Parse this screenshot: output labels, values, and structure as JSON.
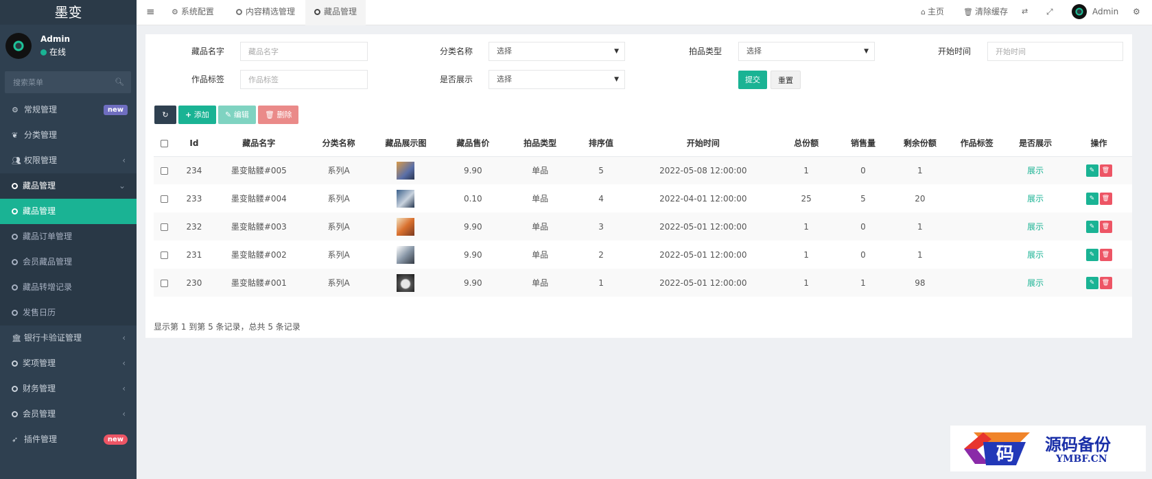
{
  "app": {
    "title": "墨变",
    "user_name": "Admin",
    "user_status": "在线",
    "search_placeholder": "搜索菜单"
  },
  "sidebar": {
    "items": [
      {
        "label": "常规管理",
        "icon": "gears-icon",
        "badge": "new",
        "badge_color": "#6f6ec0"
      },
      {
        "label": "分类管理",
        "icon": "leaf-icon"
      },
      {
        "label": "权限管理",
        "icon": "users-icon",
        "arrow": "‹"
      },
      {
        "label": "藏品管理",
        "icon": "circle-icon",
        "arrow": "⌄",
        "state": "open"
      },
      {
        "label": "藏品管理",
        "icon": "circle-icon",
        "state": "active"
      },
      {
        "label": "藏品订单管理",
        "icon": "circle-icon",
        "state": "sub"
      },
      {
        "label": "会员藏品管理",
        "icon": "circle-icon",
        "state": "sub"
      },
      {
        "label": "藏品转增记录",
        "icon": "circle-icon",
        "state": "sub"
      },
      {
        "label": "发售日历",
        "icon": "circle-icon",
        "state": "sub"
      },
      {
        "label": "银行卡验证管理",
        "icon": "bank-icon",
        "arrow": "‹"
      },
      {
        "label": "奖项管理",
        "icon": "circle-icon",
        "arrow": "‹"
      },
      {
        "label": "财务管理",
        "icon": "circle-icon",
        "arrow": "‹"
      },
      {
        "label": "会员管理",
        "icon": "circle-icon",
        "arrow": "‹"
      },
      {
        "label": "插件管理",
        "icon": "rocket-icon",
        "badge": "new",
        "badge_color": "#ed5565"
      }
    ]
  },
  "topbar": {
    "menu_icon": "≡",
    "tabs": [
      {
        "label": "系统配置",
        "icon": "gear-icon"
      },
      {
        "label": "内容精选管理",
        "icon": "circle-icon"
      },
      {
        "label": "藏品管理",
        "icon": "circle-icon",
        "active": true
      }
    ],
    "home": "主页",
    "clear_cache": "清除缓存",
    "user": "Admin"
  },
  "filters": {
    "name_label": "藏品名字",
    "name_placeholder": "藏品名字",
    "category_label": "分类名称",
    "category_value": "选择",
    "type_label": "拍品类型",
    "type_value": "选择",
    "start_label": "开始时间",
    "start_placeholder": "开始时间",
    "tag_label": "作品标签",
    "tag_placeholder": "作品标签",
    "show_label": "是否展示",
    "show_value": "选择",
    "submit": "提交",
    "reset": "重置"
  },
  "toolbar": {
    "add": "添加",
    "edit": "编辑",
    "delete": "删除"
  },
  "table": {
    "columns": [
      "Id",
      "藏品名字",
      "分类名称",
      "藏品展示图",
      "藏品售价",
      "拍品类型",
      "排序值",
      "开始时间",
      "总份额",
      "销售量",
      "剩余份额",
      "作品标签",
      "是否展示",
      "操作"
    ],
    "rows": [
      {
        "id": "234",
        "name": "墨变骷髅#005",
        "category": "系列A",
        "price": "9.90",
        "type": "单品",
        "sort": "5",
        "start": "2022-05-08 12:00:00",
        "total": "1",
        "sold": "0",
        "remain": "1",
        "tag": "",
        "show": "展示"
      },
      {
        "id": "233",
        "name": "墨变骷髅#004",
        "category": "系列A",
        "price": "0.10",
        "type": "单品",
        "sort": "4",
        "start": "2022-04-01 12:00:00",
        "total": "25",
        "sold": "5",
        "remain": "20",
        "tag": "",
        "show": "展示"
      },
      {
        "id": "232",
        "name": "墨变骷髅#003",
        "category": "系列A",
        "price": "9.90",
        "type": "单品",
        "sort": "3",
        "start": "2022-05-01 12:00:00",
        "total": "1",
        "sold": "0",
        "remain": "1",
        "tag": "",
        "show": "展示"
      },
      {
        "id": "231",
        "name": "墨变骷髅#002",
        "category": "系列A",
        "price": "9.90",
        "type": "单品",
        "sort": "2",
        "start": "2022-05-01 12:00:00",
        "total": "1",
        "sold": "0",
        "remain": "1",
        "tag": "",
        "show": "展示"
      },
      {
        "id": "230",
        "name": "墨变骷髅#001",
        "category": "系列A",
        "price": "9.90",
        "type": "单品",
        "sort": "1",
        "start": "2022-05-01 12:00:00",
        "total": "1",
        "sold": "1",
        "remain": "98",
        "tag": "",
        "show": "展示"
      }
    ],
    "footer": "显示第 1 到第 5 条记录，总共 5 条记录"
  },
  "watermark": {
    "title": "源码备份",
    "site": "YMBF.CN",
    "logo_char": "码"
  },
  "colors": {
    "sidebar": "#2f4050",
    "accent": "#1ab394",
    "danger": "#ed5565"
  }
}
